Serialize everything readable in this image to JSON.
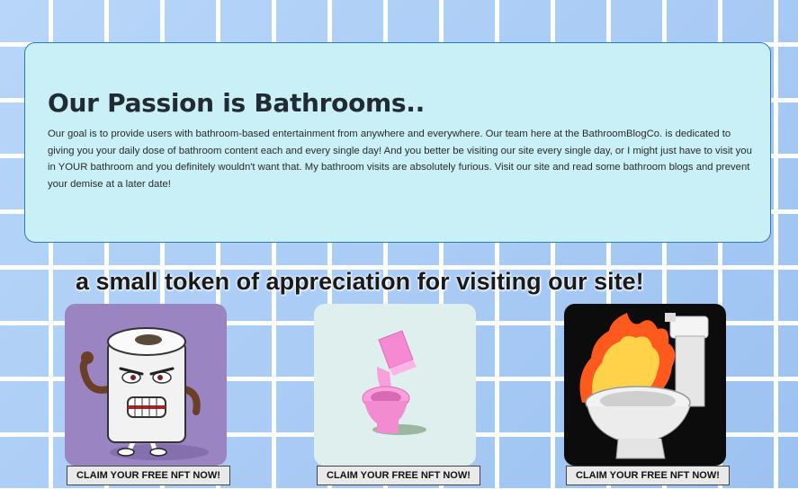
{
  "about": {
    "title": "Our Passion is Bathrooms..",
    "body": "Our goal is to provide users with bathroom-based entertainment from anywhere and everywhere. Our team here at the BathroomBlogCo. is dedicated to giving you your daily dose of bathroom content each and every single day! And you better be visiting our site every single day, or I might just have to visit you in YOUR bathroom and you definitely wouldn't want that. My bathroom visits are absolutely furious. Visit our site and read some bathroom blogs and prevent your demise at a later date!"
  },
  "tagline": "a small token of appreciation for visiting our site!",
  "nfts": [
    {
      "icon": "angry-toilet-paper-image",
      "button_label": "CLAIM YOUR FREE NFT NOW!",
      "bg": "#9a84c2"
    },
    {
      "icon": "pink-toilet-image",
      "button_label": "CLAIM YOUR FREE NFT NOW!",
      "bg": "#dfefee"
    },
    {
      "icon": "flaming-toilet-image",
      "button_label": "CLAIM YOUR FREE NFT NOW!",
      "bg": "#0c0c0c"
    }
  ]
}
